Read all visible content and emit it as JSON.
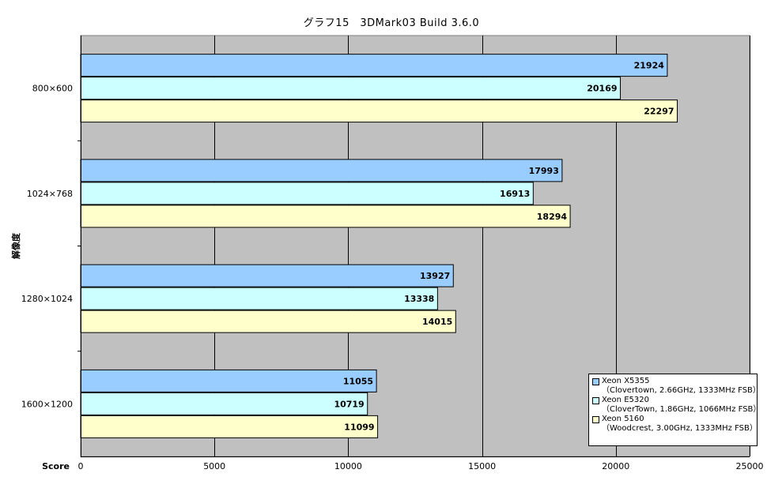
{
  "chart_data": {
    "type": "bar",
    "orientation": "horizontal",
    "title": "グラフ15　3DMark03  Build 3.6.0",
    "xlabel": "Score",
    "ylabel": "解像度",
    "xlim": [
      0,
      25000
    ],
    "xticks": [
      0,
      5000,
      10000,
      15000,
      20000,
      25000
    ],
    "categories": [
      "800×600",
      "1024×768",
      "1280×1024",
      "1600×1200"
    ],
    "series": [
      {
        "name": "Xeon X5355",
        "detail": "（Clovertown, 2.66GHz, 1333MHz FSB）",
        "color": "#99ccff",
        "values": [
          21924,
          17993,
          13927,
          11055
        ]
      },
      {
        "name": "Xeon E5320",
        "detail": "（CloverTown, 1.86GHz, 1066MHz FSB）",
        "color": "#ccffff",
        "values": [
          20169,
          16913,
          13338,
          10719
        ]
      },
      {
        "name": "Xeon 5160",
        "detail": "（Woodcrest, 3.00GHz, 1333MHz FSB）",
        "color": "#ffffcc",
        "values": [
          22297,
          18294,
          14015,
          11099
        ]
      }
    ],
    "grid": true,
    "plot_background": "#c0c0c0",
    "legend_position": "bottom-right"
  }
}
